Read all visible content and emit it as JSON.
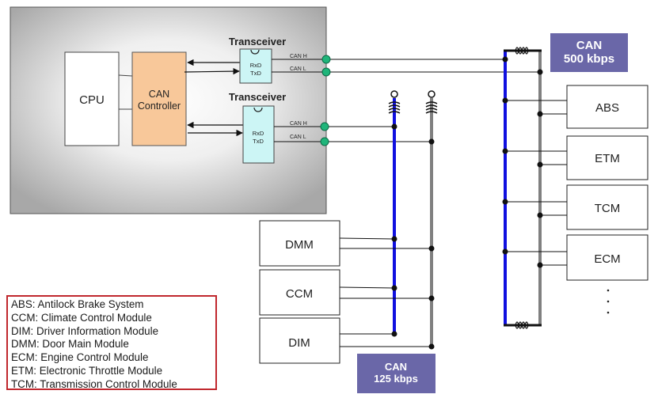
{
  "diagram": {
    "ecu": {
      "cpu_label": "CPU",
      "controller_label_line1": "CAN",
      "controller_label_line2": "Controller",
      "transceivers": [
        {
          "title": "Transceiver",
          "rx": "RxD",
          "tx": "TxD",
          "can_h": "CAN H",
          "can_l": "CAN L"
        },
        {
          "title": "Transceiver",
          "rx": "RxD",
          "tx": "TxD",
          "can_h": "CAN H",
          "can_l": "CAN L"
        }
      ]
    },
    "bus_high_speed": {
      "label_line1": "CAN",
      "label_line2": "500 kbps",
      "nodes": [
        "ABS",
        "ETM",
        "TCM",
        "ECM"
      ],
      "more": "⋮"
    },
    "bus_low_speed": {
      "label_line1": "CAN",
      "label_line2": "125 kbps",
      "nodes": [
        "DMM",
        "CCM",
        "DIM"
      ]
    },
    "colors": {
      "can_high_wire": "#1010e0",
      "can_low_wire": "#808080",
      "controller_fill": "#f8c89a",
      "transceiver_fill": "#ccf5f5",
      "connector": "#1fb57a",
      "bus_badge": "#6a67a8",
      "legend_border": "#c0272d"
    }
  },
  "legend": {
    "items": [
      "ABS: Antilock Brake System",
      "CCM: Climate Control Module",
      "DIM: Driver Information Module",
      "DMM: Door Main Module",
      "ECM: Engine Control Module",
      "ETM: Electronic Throttle Module",
      "TCM: Transmission Control Module"
    ]
  }
}
